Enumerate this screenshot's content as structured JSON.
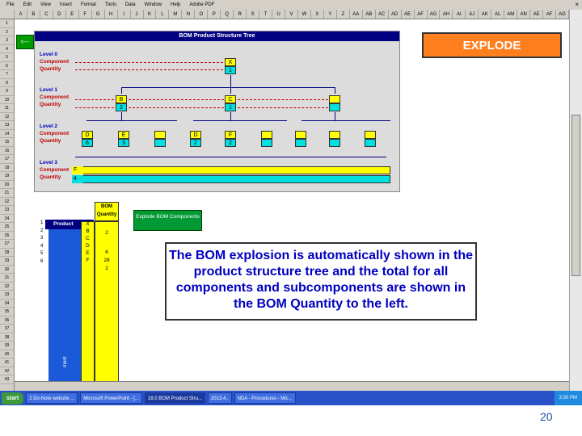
{
  "menu": {
    "items": [
      "File",
      "Edit",
      "View",
      "Insert",
      "Format",
      "Tools",
      "Data",
      "Window",
      "Help",
      "Adobe PDF"
    ],
    "close": "×"
  },
  "columns": [
    "A",
    "B",
    "C",
    "D",
    "E",
    "F",
    "G",
    "H",
    "I",
    "J",
    "K",
    "L",
    "M",
    "N",
    "O",
    "P",
    "Q",
    "R",
    "S",
    "T",
    "U",
    "V",
    "W",
    "X",
    "Y",
    "Z",
    "AA",
    "AB",
    "AC",
    "AD",
    "AE",
    "AF",
    "AG",
    "AH",
    "AI",
    "AJ",
    "AK",
    "AL",
    "AM",
    "AN",
    "AE",
    "AF",
    "AG"
  ],
  "rows": [
    "1",
    "2",
    "3",
    "4",
    "5",
    "6",
    "7",
    "8",
    "9",
    "10",
    "11",
    "12",
    "13",
    "14",
    "15",
    "16",
    "17",
    "18",
    "19",
    "20",
    "21",
    "22",
    "23",
    "24",
    "25",
    "26",
    "27",
    "28",
    "29",
    "30",
    "31",
    "32",
    "33",
    "34",
    "35",
    "36",
    "37",
    "38",
    "39",
    "40",
    "41",
    "42",
    "43"
  ],
  "back_button": "<---",
  "tree": {
    "title": "BOM Product Structure Tree",
    "level0": {
      "label": "Level 0",
      "component": "Component",
      "quantity": "Quantity",
      "comp_val": "X",
      "qty_val": "1"
    },
    "level1": {
      "label": "Level 1",
      "component": "Component",
      "quantity": "Quantity",
      "b_comp": "B",
      "b_qty": "2",
      "c_comp": "C",
      "c_qty": "1"
    },
    "level2": {
      "label": "Level 2",
      "component": "Component",
      "quantity": "Quantity",
      "d_comp": "D",
      "d_qty": "6",
      "e_comp": "E",
      "e_qty": "3",
      "d2_comp": "D",
      "d2_qty": "2",
      "f_comp": "F",
      "f_qty": "2"
    },
    "level3": {
      "label": "Level 3",
      "component": "Component",
      "quantity": "Quantity",
      "f_comp": "F",
      "f_qty": "4"
    }
  },
  "explode_label": "EXPLODE",
  "bom": {
    "qty_header": "BOM Quantity",
    "product_header": "Product",
    "vertical_label": "ment",
    "row_numbers": [
      "1",
      "2",
      "3",
      "4",
      "5",
      "6"
    ],
    "components": [
      "X",
      "B",
      "C",
      "D",
      "E",
      "F"
    ],
    "quantities": [
      "2",
      "",
      "",
      "6",
      "28",
      "2"
    ]
  },
  "explode_button": "Explode BOM Components",
  "callout": "The BOM explosion is automatically shown in the product structure tree and the total for all components and subcomponents are shown in the BOM Quantity to the left.",
  "taskbar": {
    "start": "start",
    "tasks": [
      "2 Do-Note website ...",
      "Microsoft PowerPoint - [...",
      "18.0 BOM Product Stru...",
      "2013.4..",
      "NDA - Procedures - Mic..."
    ],
    "clock": "3:30 PM"
  },
  "page_number": "20"
}
